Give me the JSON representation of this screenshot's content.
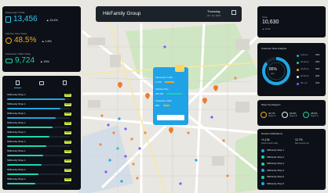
{
  "header": {
    "title": "HikFamily Group",
    "day": "Thursday",
    "date": "20 / 12 / 2022"
  },
  "left_stats": [
    {
      "label": "Passengers Traffic",
      "value": "13,456",
      "delta": "▲ 15.4%",
      "icon": "building-icon",
      "color": "#36c6f4"
    },
    {
      "label": "Vehicles Flow Today",
      "value": "48.5%",
      "delta": "▲ 1.8%",
      "icon": "pie-icon",
      "color": "#f5a524"
    },
    {
      "label": "Pedestrian Traffic Today",
      "value": "9,724",
      "delta": "▲ 15%",
      "icon": "car-icon",
      "color": "#19d3a2"
    }
  ],
  "shop_tabs": [
    {
      "icon": "store-icon"
    },
    {
      "icon": "camera-icon"
    },
    {
      "icon": "bag-icon"
    }
  ],
  "shop_list": [
    {
      "label": "SMFamily Shop 1",
      "pill": "180%",
      "fill": 0.92,
      "color": "#1ea7e4"
    },
    {
      "label": "SMFamily Shop 1",
      "pill": "180%",
      "fill": 0.85,
      "color": "#1ea7e4"
    },
    {
      "label": "SMFamily Shop 1",
      "pill": "180%",
      "fill": 0.78,
      "color": "#1ea7e4"
    },
    {
      "label": "SMFamily Shop 1",
      "pill": "180%",
      "fill": 0.72,
      "color": "#20d6b0"
    },
    {
      "label": "SMFamily Shop 1",
      "pill": "180%",
      "fill": 0.68,
      "color": "#20d6b0"
    },
    {
      "label": "SMFamily Shop 1",
      "pill": "180%",
      "fill": 0.62,
      "color": "#20d6b0"
    },
    {
      "label": "SMFamily Shop 1",
      "pill": "180%",
      "fill": 0.58,
      "color": "#20d6b0"
    },
    {
      "label": "SMFamily Shop 1",
      "pill": "180%",
      "fill": 0.55,
      "color": "#20d6b0"
    },
    {
      "label": "SMFamily Shop 1",
      "pill": "180%",
      "fill": 0.5,
      "color": "#20d6b0"
    },
    {
      "label": "SMFamily Shop 1",
      "pill": "180%",
      "fill": 0.45,
      "color": "#20d6b0"
    }
  ],
  "popup": {
    "rows": [
      {
        "label": "Passengers Traffic",
        "value": "1,732",
        "bar": 0.6,
        "color": "#f5a524"
      },
      {
        "label": "Vehicles Flow",
        "value": "100.0%",
        "bar": 1.0,
        "color": "#19d3a2"
      },
      {
        "label": "Pedestrian Traffic",
        "value": "956",
        "bar": 0.4,
        "color": "#f5a524"
      }
    ],
    "button": "Detail"
  },
  "right_top": {
    "label": "Total",
    "value": "10,630",
    "delta": "▲ 8.2%"
  },
  "ring": {
    "title": "Customer Flow Analysis",
    "value": "86%",
    "caption": "ratio"
  },
  "ring_legend": [
    {
      "label": "0-19 yrs",
      "value": "15%",
      "color": "#1ea7e4"
    },
    {
      "label": "20-29 yrs",
      "value": "25%",
      "color": "#19d3a2"
    },
    {
      "label": "30-39 yrs",
      "value": "30%",
      "color": "#f5a524"
    },
    {
      "label": "40-49 yrs",
      "value": "20%",
      "color": "#e8eef5"
    },
    {
      "label": "50+ yrs",
      "value": "10%",
      "color": "#7a5cff"
    }
  ],
  "top_regions": {
    "title": "Shop Top Regions",
    "items": [
      {
        "value": "40.7%",
        "label": "Region A",
        "color": "#f5a524"
      },
      {
        "value": "30.8%",
        "label": "Region B",
        "color": "#e8eef5"
      },
      {
        "value": "28.5%",
        "label": "Region C",
        "color": "#19d3a2"
      }
    ]
  },
  "review": {
    "title": "Review Notifications",
    "left_value": "+1,134",
    "left_label": "Good reviews today",
    "right_value": "12.7%",
    "right_label": "Bad reviews rate",
    "items": [
      {
        "label": "SMFamily Shop 1",
        "color": "#1ea7e4"
      },
      {
        "label": "SMFamily Shop 2",
        "color": "#19d3a2"
      },
      {
        "label": "SMFamily Shop 3",
        "color": "#19d3a2"
      },
      {
        "label": "SMFamily Shop 4",
        "color": "#1ea7e4"
      },
      {
        "label": "SMFamily Shop 5",
        "color": "#19d3a2"
      },
      {
        "label": "SMFamily Shop 6",
        "color": "#1ea7e4"
      }
    ]
  }
}
